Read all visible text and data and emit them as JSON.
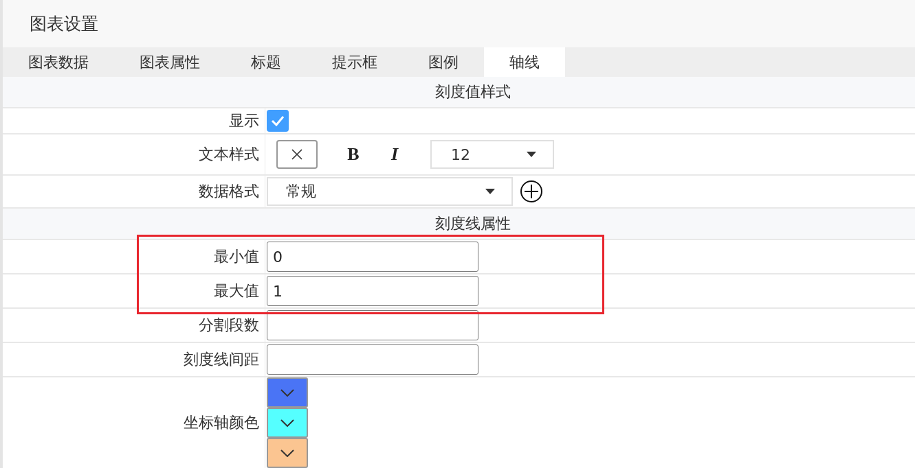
{
  "title": "图表设置",
  "tabs": [
    {
      "label": "图表数据",
      "selected": false
    },
    {
      "label": "图表属性",
      "selected": false
    },
    {
      "label": "标题",
      "selected": false
    },
    {
      "label": "提示框",
      "selected": false
    },
    {
      "label": "图例",
      "selected": false
    },
    {
      "label": "轴线",
      "selected": true
    }
  ],
  "sections": [
    {
      "title": "刻度值样式",
      "rows": [
        {
          "kind": "checkbox",
          "label": "显示",
          "checked": true
        },
        {
          "kind": "text_style",
          "label": "文本样式",
          "bold": "B",
          "italic": "I",
          "font_size": "12"
        },
        {
          "kind": "select",
          "label": "数据格式",
          "value": "常规"
        }
      ]
    },
    {
      "title": "刻度线属性",
      "rows": [
        {
          "kind": "input",
          "label": "最小值",
          "value": "0",
          "highlighted": true
        },
        {
          "kind": "input",
          "label": "最大值",
          "value": "1",
          "highlighted": true
        },
        {
          "kind": "input",
          "label": "分割段数",
          "value": ""
        },
        {
          "kind": "input",
          "label": "刻度线间距",
          "value": ""
        },
        {
          "kind": "colors",
          "label": "坐标轴颜色",
          "swatches": [
            {
              "color": "#4a74f5"
            },
            {
              "color": "#55ffff"
            },
            {
              "color": "#fbc591"
            }
          ]
        }
      ]
    }
  ]
}
